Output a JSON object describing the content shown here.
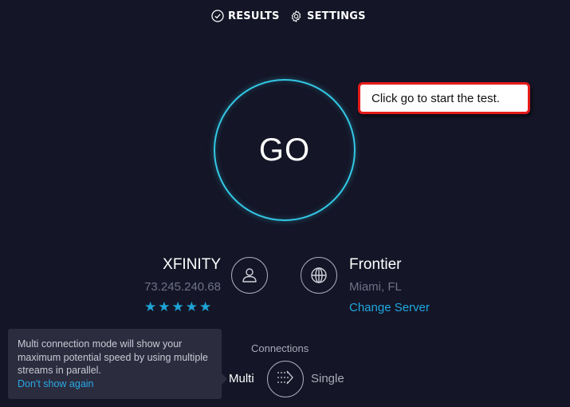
{
  "nav": {
    "results_label": "RESULTS",
    "settings_label": "SETTINGS",
    "results_icon": "check-circle-icon",
    "settings_icon": "gear-icon"
  },
  "go_button": {
    "label": "GO"
  },
  "callout": {
    "text": "Click go to start the test."
  },
  "isp": {
    "name": "XFINITY",
    "ip": "73.245.240.68",
    "rating": 5,
    "rating_max": 5,
    "icon": "user-icon"
  },
  "server": {
    "name": "Frontier",
    "location": "Miami, FL",
    "change_label": "Change Server",
    "icon": "globe-icon"
  },
  "tooltip": {
    "text": "Multi connection mode will show your maximum potential speed by using multiple streams in parallel.",
    "link_label": "Don't show again"
  },
  "connections": {
    "label": "Connections",
    "multi_label": "Multi",
    "single_label": "Single",
    "selected": "Multi",
    "icon": "multi-stream-icon"
  },
  "colors": {
    "background": "#141526",
    "accent": "#33c9e6",
    "link": "#1fa8e0",
    "callout_border": "#e51b1b"
  }
}
